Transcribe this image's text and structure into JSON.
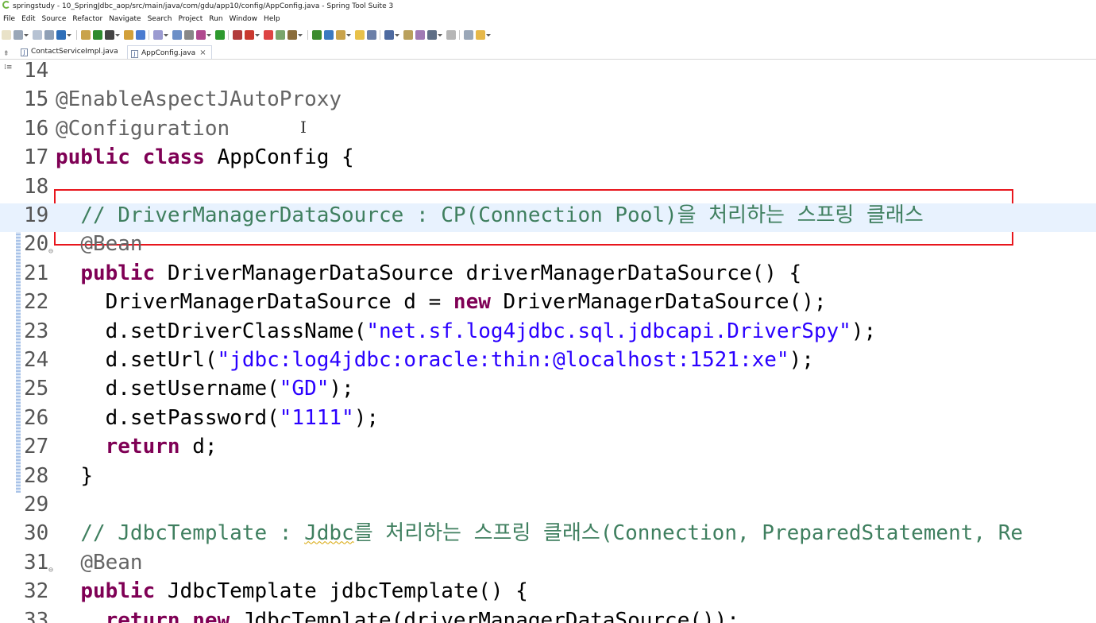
{
  "window": {
    "title": "springstudy - 10_SpringJdbc_aop/src/main/java/com/gdu/app10/config/AppConfig.java - Spring Tool Suite 3"
  },
  "menu": [
    "File",
    "Edit",
    "Source",
    "Refactor",
    "Navigate",
    "Search",
    "Project",
    "Run",
    "Window",
    "Help"
  ],
  "tabs": [
    {
      "label": "ContactServiceImpl.java",
      "active": false
    },
    {
      "label": "AppConfig.java",
      "active": true,
      "close": "×"
    }
  ],
  "editor": {
    "lines": [
      {
        "n": "14",
        "indent": "",
        "parts": []
      },
      {
        "n": "15",
        "indent": "",
        "parts": [
          {
            "t": "@EnableAspectJAutoProxy",
            "c": "ann"
          }
        ]
      },
      {
        "n": "16",
        "indent": "",
        "parts": [
          {
            "t": "@Configuration",
            "c": "ann"
          }
        ]
      },
      {
        "n": "17",
        "indent": "",
        "parts": [
          {
            "t": "public",
            "c": "kw"
          },
          {
            "t": " "
          },
          {
            "t": "class",
            "c": "kw"
          },
          {
            "t": " AppConfig {"
          }
        ]
      },
      {
        "n": "18",
        "indent": "",
        "parts": []
      },
      {
        "n": "19",
        "indent": "  ",
        "parts": [
          {
            "t": "// DriverManagerDataSource : CP(Connection Pool)을 처리하는 스프링 클래스",
            "c": "cm"
          }
        ]
      },
      {
        "n": "20",
        "indent": "  ",
        "fold": "⊖",
        "parts": [
          {
            "t": "@Bean",
            "c": "ann"
          }
        ]
      },
      {
        "n": "21",
        "indent": "  ",
        "parts": [
          {
            "t": "public",
            "c": "kw"
          },
          {
            "t": " DriverManagerDataSource driverManagerDataSource() {"
          }
        ]
      },
      {
        "n": "22",
        "indent": "    ",
        "parts": [
          {
            "t": "DriverManagerDataSource d = "
          },
          {
            "t": "new",
            "c": "kw"
          },
          {
            "t": " DriverManagerDataSource();"
          }
        ]
      },
      {
        "n": "23",
        "indent": "    ",
        "parts": [
          {
            "t": "d.setDriverClassName("
          },
          {
            "t": "\"net.sf.log4jdbc.sql.jdbcapi.DriverSpy\"",
            "c": "str"
          },
          {
            "t": ");"
          }
        ]
      },
      {
        "n": "24",
        "indent": "    ",
        "parts": [
          {
            "t": "d.setUrl("
          },
          {
            "t": "\"jdbc:log4jdbc:oracle:thin:@localhost:1521:xe\"",
            "c": "str"
          },
          {
            "t": ");"
          }
        ]
      },
      {
        "n": "25",
        "indent": "    ",
        "parts": [
          {
            "t": "d.setUsername("
          },
          {
            "t": "\"GD\"",
            "c": "str"
          },
          {
            "t": ");"
          }
        ]
      },
      {
        "n": "26",
        "indent": "    ",
        "parts": [
          {
            "t": "d.setPassword("
          },
          {
            "t": "\"1111\"",
            "c": "str"
          },
          {
            "t": ");"
          }
        ]
      },
      {
        "n": "27",
        "indent": "    ",
        "parts": [
          {
            "t": "return",
            "c": "kw"
          },
          {
            "t": " d;"
          }
        ]
      },
      {
        "n": "28",
        "indent": "  ",
        "parts": [
          {
            "t": "}"
          }
        ]
      },
      {
        "n": "29",
        "indent": "",
        "parts": []
      },
      {
        "n": "30",
        "indent": "  ",
        "parts": [
          {
            "t": "// JdbcTemplate : ",
            "c": "cm"
          },
          {
            "t": "Jdbc",
            "c": "cm sq"
          },
          {
            "t": "를 처리하는 스프링 클래스(Connection, PreparedStatement, Re",
            "c": "cm"
          }
        ]
      },
      {
        "n": "31",
        "indent": "  ",
        "fold": "⊖",
        "parts": [
          {
            "t": "@Bean",
            "c": "ann"
          }
        ]
      },
      {
        "n": "32",
        "indent": "  ",
        "parts": [
          {
            "t": "public",
            "c": "kw"
          },
          {
            "t": " JdbcTemplate jdbcTemplate() {"
          }
        ]
      },
      {
        "n": "33",
        "indent": "    ",
        "parts": [
          {
            "t": "return",
            "c": "kw"
          },
          {
            "t": " "
          },
          {
            "t": "new",
            "c": "kw"
          },
          {
            "t": " JdbcTemplate(driverManagerDataSource());"
          }
        ]
      }
    ]
  }
}
